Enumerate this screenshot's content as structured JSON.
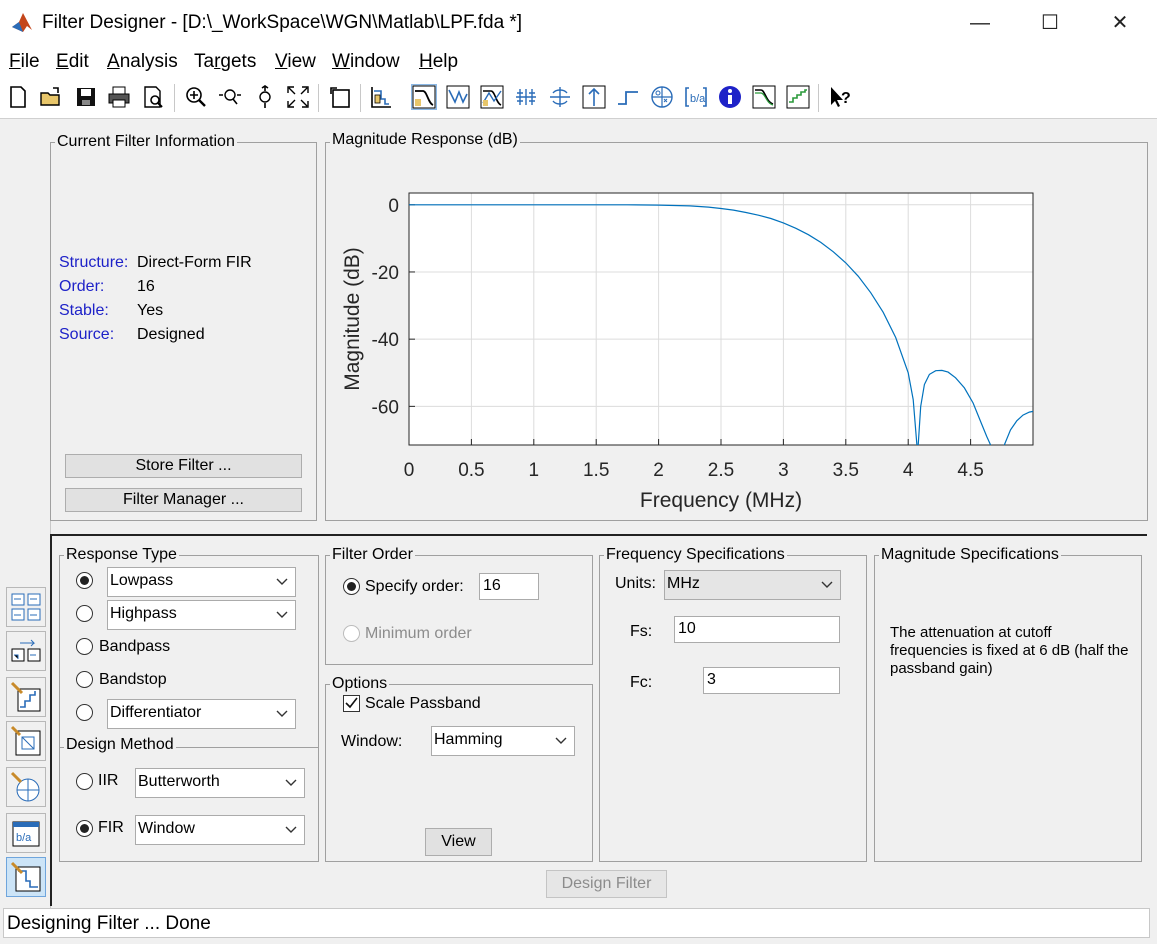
{
  "window": {
    "title": "Filter Designer -  [D:\\_WorkSpace\\WGN\\Matlab\\LPF.fda *]",
    "minimize": "—",
    "maximize": "☐",
    "close": "✕"
  },
  "menu": [
    {
      "accel": "F",
      "rest": "ile"
    },
    {
      "accel": "E",
      "rest": "dit"
    },
    {
      "accel": "A",
      "rest": "nalysis"
    },
    {
      "pre": "Ta",
      "accel": "r",
      "rest": "gets"
    },
    {
      "accel": "V",
      "rest": "iew"
    },
    {
      "accel": "W",
      "rest": "indow"
    },
    {
      "accel": "H",
      "rest": "elp"
    }
  ],
  "toolbar_icons": [
    "new-file-icon",
    "open-folder-icon",
    "save-icon",
    "print-icon",
    "print-preview-icon",
    "zoom-in-icon",
    "zoom-x-icon",
    "zoom-y-icon",
    "full-view-icon",
    "new-figure-icon",
    "filter-specs-icon",
    "magnitude-response-icon",
    "phase-response-icon",
    "magnitude-phase-icon",
    "group-delay-icon",
    "phase-delay-icon",
    "impulse-response-icon",
    "step-response-icon",
    "pole-zero-icon",
    "coefficients-icon",
    "filter-info-icon",
    "magnitude-estimate-icon",
    "round-off-noise-icon",
    "whats-this-icon"
  ],
  "current_filter_info": {
    "title": "Current Filter Information",
    "rows": [
      {
        "label": "Structure:",
        "value": "Direct-Form FIR"
      },
      {
        "label": "Order:",
        "value": "16"
      },
      {
        "label": "Stable:",
        "value": "Yes"
      },
      {
        "label": "Source:",
        "value": "Designed"
      }
    ],
    "store_button": "Store Filter ...",
    "manager_button": "Filter Manager ..."
  },
  "magnitude_panel": {
    "title": "Magnitude Response (dB)"
  },
  "chart_data": {
    "type": "line",
    "xlabel": "Frequency (MHz)",
    "ylabel": "Magnitude (dB)",
    "xlim": [
      0,
      5
    ],
    "ylim": [
      -71.5,
      3.5
    ],
    "xticks": [
      "0",
      "0.5",
      "1",
      "1.5",
      "2",
      "2.5",
      "3",
      "3.5",
      "4",
      "4.5"
    ],
    "yticks": [
      "0",
      "-20",
      "-40",
      "-60"
    ],
    "grid": true,
    "line_color": "#0072bd",
    "series": [
      {
        "x": [
          0,
          0.25,
          0.5,
          0.75,
          1,
          1.25,
          1.5,
          1.75,
          2,
          2.25,
          2.4,
          2.5,
          2.6,
          2.7,
          2.8,
          2.9,
          3,
          3.1,
          3.2,
          3.3,
          3.4,
          3.5,
          3.6,
          3.7,
          3.8,
          3.9,
          4,
          4.04,
          4.07
        ],
        "y": [
          0,
          0,
          0,
          0,
          0,
          0,
          0,
          -0.02,
          -0.1,
          -0.35,
          -0.7,
          -1.1,
          -1.6,
          -2.3,
          -3.1,
          -4.1,
          -5.4,
          -7,
          -8.9,
          -11.2,
          -14,
          -17.3,
          -21.3,
          -26.2,
          -32,
          -39.5,
          -50,
          -58,
          -71.5
        ]
      },
      {
        "x": [
          4.08,
          4.1,
          4.13,
          4.17,
          4.22,
          4.27,
          4.32,
          4.38,
          4.45,
          4.52,
          4.58,
          4.63,
          4.66
        ],
        "y": [
          -71.5,
          -60,
          -53.5,
          -50.5,
          -49.4,
          -49.3,
          -49.8,
          -51.5,
          -54.5,
          -59,
          -64.5,
          -69,
          -71.5
        ]
      },
      {
        "x": [
          4.77,
          4.82,
          4.87,
          4.92,
          4.97,
          5
        ],
        "y": [
          -71.5,
          -67,
          -64.3,
          -62.6,
          -61.7,
          -61.5
        ]
      }
    ]
  },
  "response_type": {
    "title": "Response Type",
    "options": [
      {
        "label": "Lowpass",
        "selected": true,
        "combo": true
      },
      {
        "label": "Highpass",
        "selected": false,
        "combo": true
      },
      {
        "label": "Bandpass",
        "selected": false,
        "combo": false
      },
      {
        "label": "Bandstop",
        "selected": false,
        "combo": false
      },
      {
        "label": "Differentiator",
        "selected": false,
        "combo": true
      }
    ]
  },
  "design_method": {
    "title": "Design Method",
    "iir_label": "IIR",
    "iir_value": "Butterworth",
    "fir_label": "FIR",
    "fir_value": "Window",
    "selected": "FIR"
  },
  "filter_order": {
    "title": "Filter Order",
    "specify_label": "Specify order:",
    "specify_value": "16",
    "minimum_label": "Minimum order"
  },
  "options": {
    "title": "Options",
    "scale_passband_label": "Scale Passband",
    "scale_passband_checked": true,
    "window_label": "Window:",
    "window_value": "Hamming",
    "view_button": "View"
  },
  "frequency_specs": {
    "title": "Frequency Specifications",
    "units_label": "Units:",
    "units_value": "MHz",
    "fs_label": "Fs:",
    "fs_value": "10",
    "fc_label": "Fc:",
    "fc_value": "3"
  },
  "magnitude_specs": {
    "title": "Magnitude Specifications",
    "note": "The attenuation at cutoff frequencies is fixed at 6 dB (half the passband gain)"
  },
  "design_button": "Design Filter",
  "side_icons": [
    "filter-transform-icon",
    "realize-model-icon",
    "quantize-icon",
    "pole-zero-editor-icon",
    "import-filter-icon",
    "multirate-icon",
    "design-filter-icon"
  ],
  "status": "Designing Filter ... Done"
}
